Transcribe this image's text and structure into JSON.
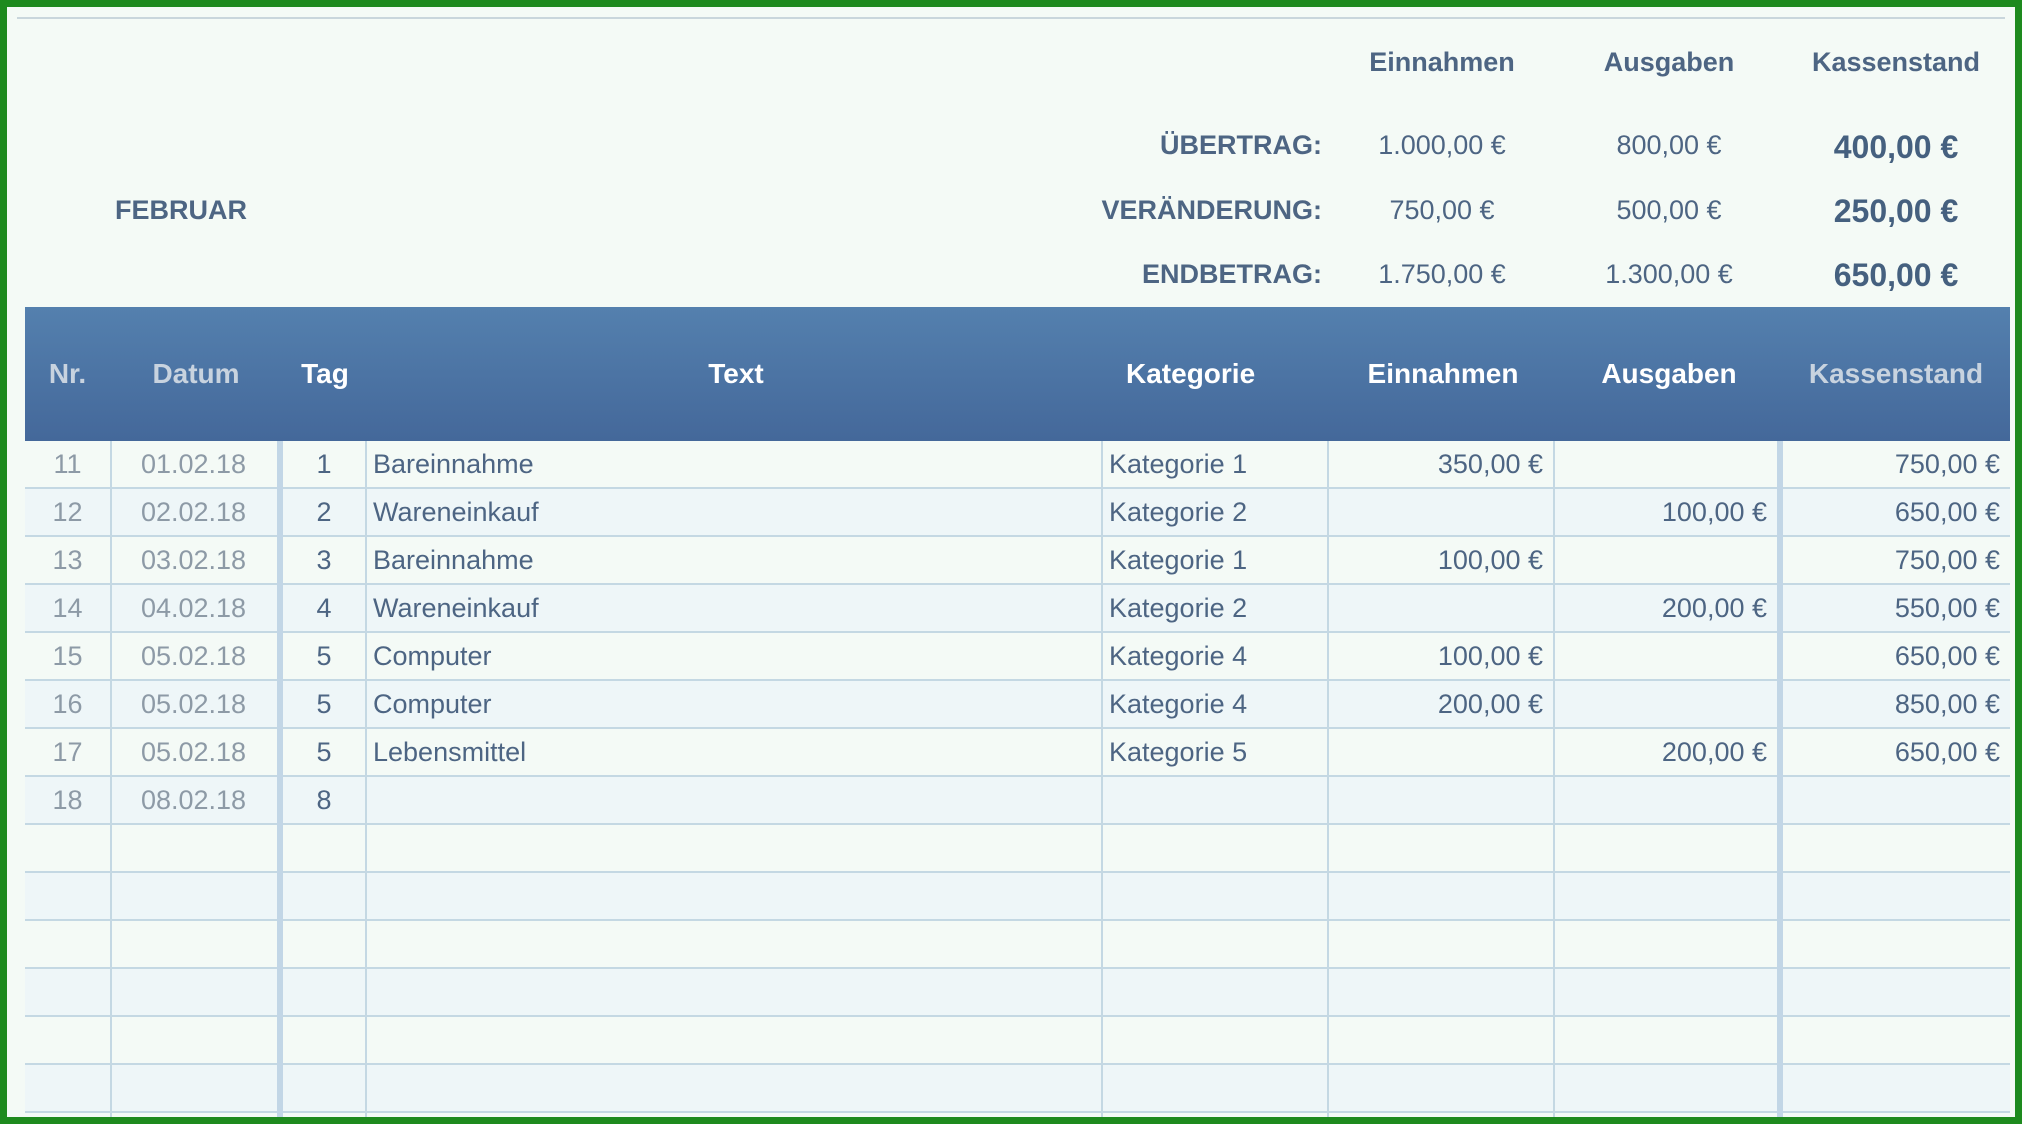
{
  "summary": {
    "headers": [
      "Einnahmen",
      "Ausgaben",
      "Kassenstand"
    ],
    "month": "FEBRUAR",
    "rows": [
      {
        "label": "ÜBERTRAG:",
        "einnahmen": "1.000,00 €",
        "ausgaben": "800,00 €",
        "kassenstand": "400,00 €"
      },
      {
        "label": "VERÄNDERUNG:",
        "einnahmen": "750,00 €",
        "ausgaben": "500,00 €",
        "kassenstand": "250,00 €"
      },
      {
        "label": "ENDBETRAG:",
        "einnahmen": "1.750,00 €",
        "ausgaben": "1.300,00 €",
        "kassenstand": "650,00 €"
      }
    ]
  },
  "table": {
    "columns": [
      "Nr.",
      "Datum",
      "Tag",
      "Text",
      "Kategorie",
      "Einnahmen",
      "Ausgaben",
      "Kassenstand"
    ],
    "rows": [
      [
        "11",
        "01.02.18",
        "1",
        "Bareinnahme",
        "Kategorie 1",
        "350,00 €",
        "",
        "750,00 €"
      ],
      [
        "12",
        "02.02.18",
        "2",
        "Wareneinkauf",
        "Kategorie 2",
        "",
        "100,00 €",
        "650,00 €"
      ],
      [
        "13",
        "03.02.18",
        "3",
        "Bareinnahme",
        "Kategorie 1",
        "100,00 €",
        "",
        "750,00 €"
      ],
      [
        "14",
        "04.02.18",
        "4",
        "Wareneinkauf",
        "Kategorie 2",
        "",
        "200,00 €",
        "550,00 €"
      ],
      [
        "15",
        "05.02.18",
        "5",
        "Computer",
        "Kategorie 4",
        "100,00 €",
        "",
        "650,00 €"
      ],
      [
        "16",
        "05.02.18",
        "5",
        "Computer",
        "Kategorie 4",
        "200,00 €",
        "",
        "850,00 €"
      ],
      [
        "17",
        "05.02.18",
        "5",
        "Lebensmittel",
        "Kategorie 5",
        "",
        "200,00 €",
        "650,00 €"
      ],
      [
        "18",
        "08.02.18",
        "8",
        "",
        "",
        "",
        "",
        ""
      ],
      [
        "",
        "",
        "",
        "",
        "",
        "",
        "",
        ""
      ],
      [
        "",
        "",
        "",
        "",
        "",
        "",
        "",
        ""
      ],
      [
        "",
        "",
        "",
        "",
        "",
        "",
        "",
        ""
      ],
      [
        "",
        "",
        "",
        "",
        "",
        "",
        "",
        ""
      ],
      [
        "",
        "",
        "",
        "",
        "",
        "",
        "",
        ""
      ],
      [
        "",
        "",
        "",
        "",
        "",
        "",
        "",
        ""
      ],
      [
        "",
        "",
        "",
        "",
        "",
        "",
        "",
        ""
      ]
    ]
  }
}
